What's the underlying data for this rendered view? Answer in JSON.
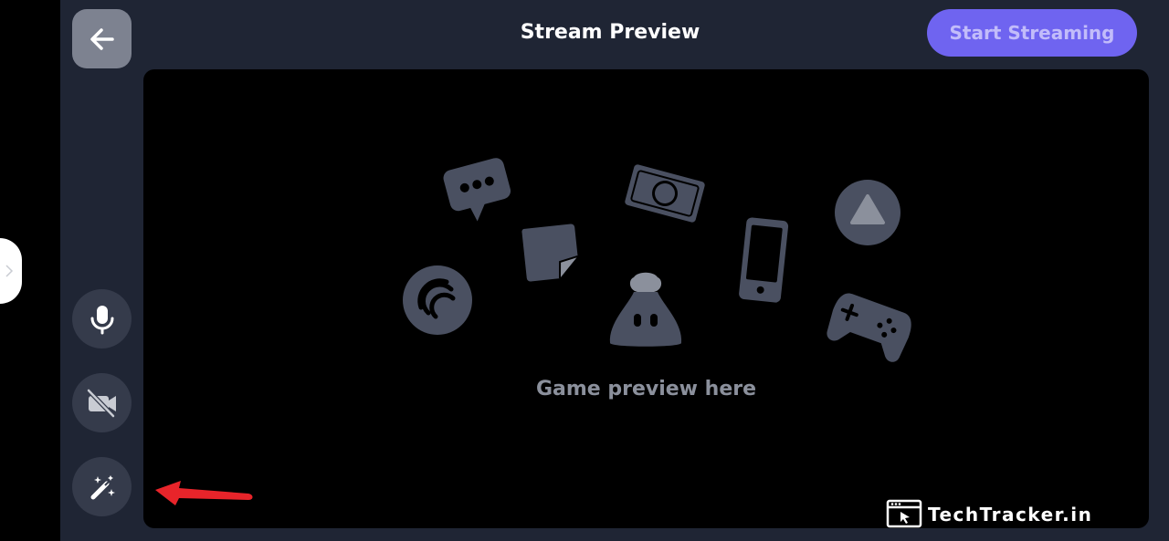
{
  "header": {
    "title": "Stream Preview",
    "start_label": "Start Streaming"
  },
  "preview": {
    "label": "Game preview here"
  },
  "watermark": {
    "text": "TechTracker.in"
  },
  "icons": {
    "back": "arrow-left-icon",
    "mic": "microphone-icon",
    "camera_off": "camera-off-icon",
    "effects": "magic-wand-icon"
  },
  "colors": {
    "app_background": "#1f2534",
    "preview_background": "#000000",
    "accent": "#6f64f0",
    "illustration": "#4a5061",
    "annotation_arrow": "#e8242a"
  }
}
